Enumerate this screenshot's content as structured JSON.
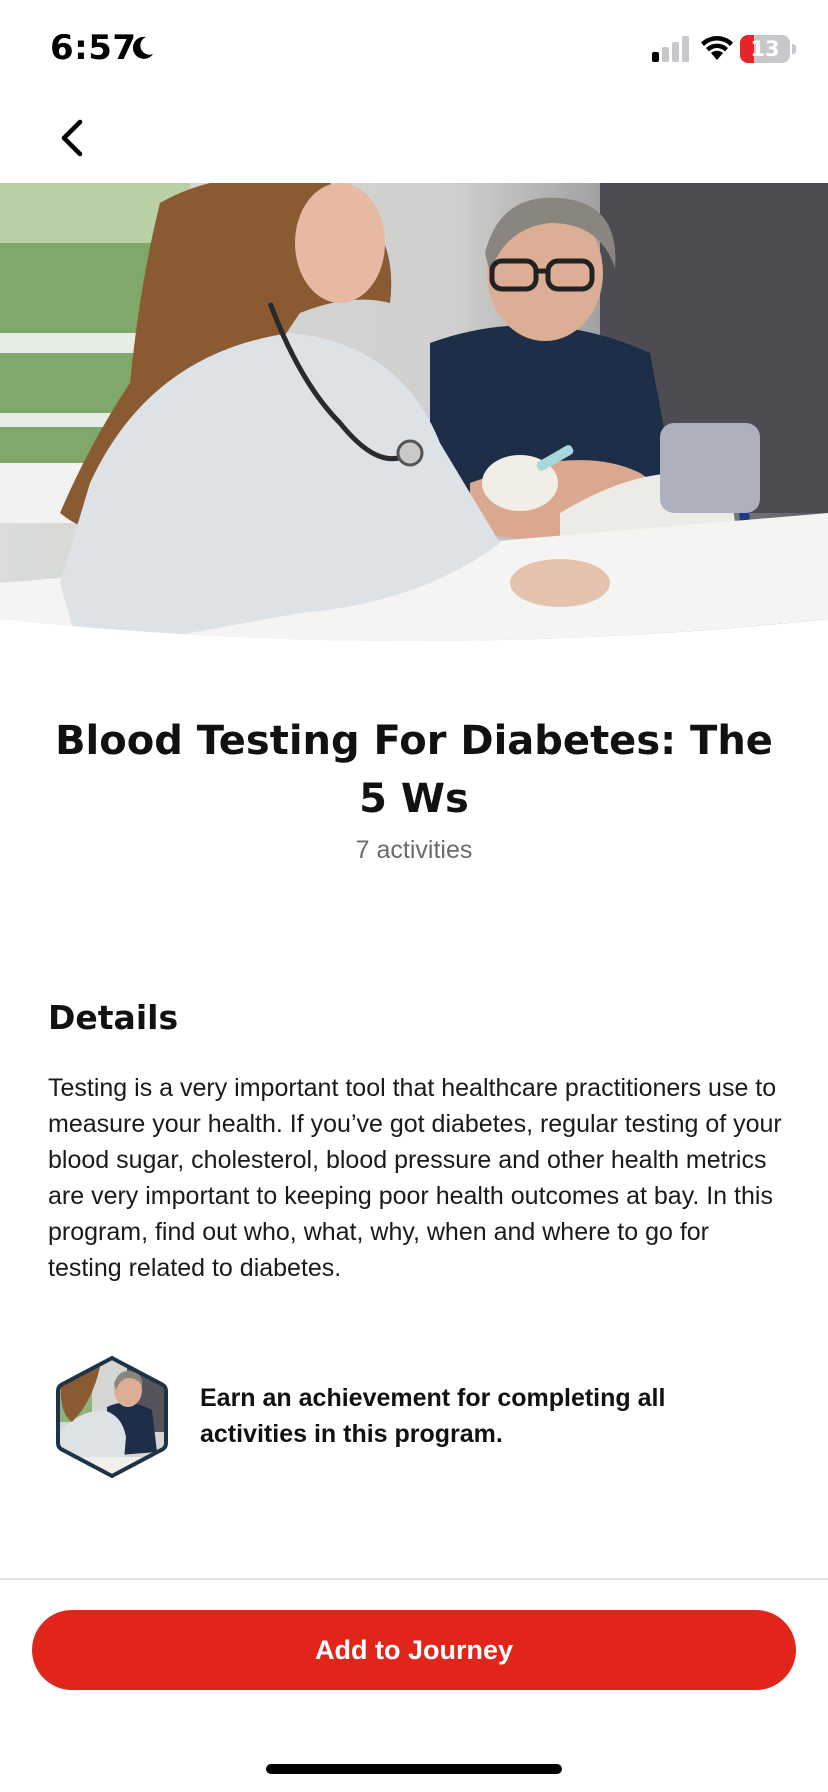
{
  "status_bar": {
    "time": "6:57",
    "battery_level": "13",
    "battery_fraction": 0.13,
    "icons": [
      "moon-icon",
      "signal-icon",
      "wifi-icon",
      "battery-icon"
    ]
  },
  "nav": {
    "back_icon": "chevron-left-icon"
  },
  "program": {
    "title": "Blood Testing For Diabetes: The 5 Ws",
    "activity_count": "7 activities"
  },
  "details": {
    "heading": "Details",
    "body": "Testing is a very important tool that healthcare practitioners use to measure your health. If you’ve got diabetes, regular testing of your blood sugar, cholesterol, blood pressure and other health metrics are very important to keeping poor health outcomes at bay. In this program, find out who, what, why, when and where to go for testing related to diabetes."
  },
  "achievement": {
    "text": "Earn an achievement for completing all activities in this program."
  },
  "footer": {
    "cta_label": "Add to Journey"
  },
  "colors": {
    "accent": "#e1251b",
    "text": "#111111",
    "muted": "#6b6b6b",
    "badge_border": "#1f3346"
  }
}
